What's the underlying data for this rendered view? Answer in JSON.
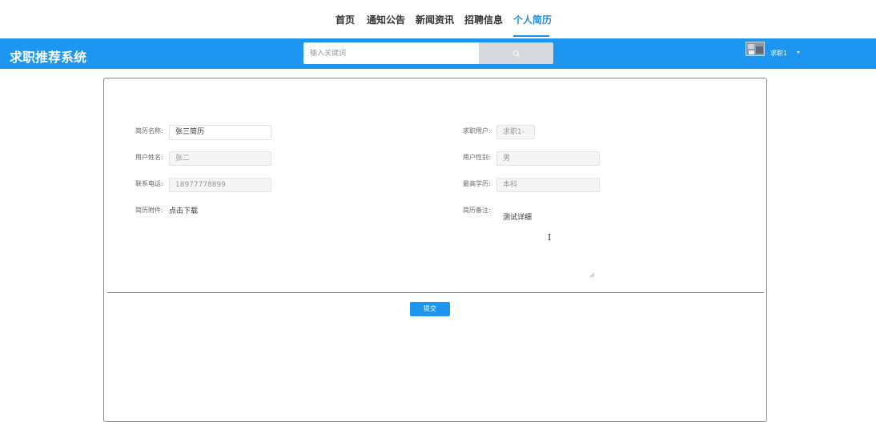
{
  "nav": {
    "items": [
      {
        "label": "首页"
      },
      {
        "label": "通知公告"
      },
      {
        "label": "新闻资讯"
      },
      {
        "label": "招聘信息"
      },
      {
        "label": "个人简历"
      }
    ],
    "active_index": 4
  },
  "header": {
    "title": "求职推荐系统",
    "search_placeholder": "输入关键词",
    "search_icon": "search-icon",
    "user_name": "求职1",
    "accent_color": "#1c96f0"
  },
  "form": {
    "resume_name": {
      "label": "简历名称:",
      "value": "张三简历"
    },
    "job_user": {
      "label": "求职用户:",
      "value": "求职1-"
    },
    "user_name": {
      "label": "用户姓名:",
      "value": "张二"
    },
    "user_gender": {
      "label": "用户性别:",
      "value": "男"
    },
    "phone": {
      "label": "联系电话:",
      "value": "18977778899"
    },
    "education": {
      "label": "最高学历:",
      "value": "本科"
    },
    "attachment": {
      "label": "简历附件:",
      "link_text": "点击下载"
    },
    "remark": {
      "label": "简历备注:",
      "value": "测试详细"
    },
    "submit_label": "提交"
  }
}
